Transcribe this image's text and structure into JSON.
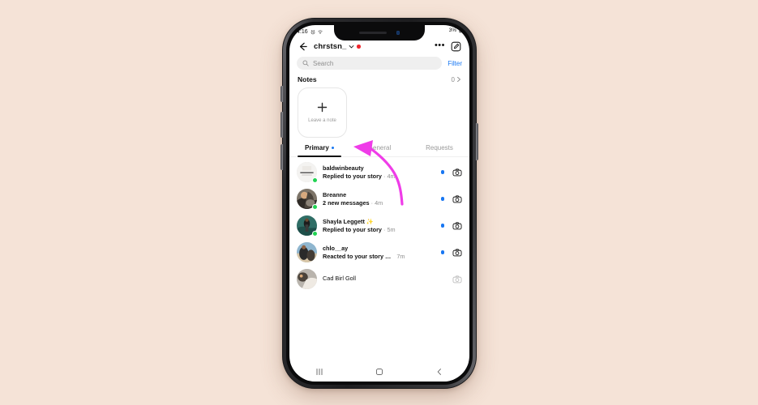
{
  "page": {
    "background_color": "#f5e3d7",
    "device": "smartphone-mockup"
  },
  "status_bar": {
    "time": "4:16",
    "battery_text": "3%",
    "icons": [
      "alarm-icon",
      "wifi-icon",
      "battery-icon"
    ]
  },
  "header": {
    "back_label": "Back",
    "username": "chrstsn_",
    "has_unread_badge": true,
    "more_label": "•••",
    "compose_label": "New message"
  },
  "search": {
    "placeholder": "Search",
    "filter_label": "Filter"
  },
  "notes": {
    "title": "Notes",
    "count": "0",
    "card_label": "Leave a note",
    "plus_label": "+"
  },
  "tabs": [
    {
      "label": "Primary",
      "active": true,
      "dot": true
    },
    {
      "label": "General",
      "active": false,
      "dot": false
    },
    {
      "label": "Requests",
      "active": false,
      "dot": false
    }
  ],
  "messages": [
    {
      "name": "baldwinbeauty",
      "preview": "Replied to your story",
      "time": "4m",
      "separator": "·",
      "unread": true,
      "online": true,
      "avatar_style": "light"
    },
    {
      "name": "Breanne",
      "preview": "2 new messages",
      "time": "4m",
      "separator": "·",
      "unread": true,
      "online": true,
      "avatar_style": "dark-photo"
    },
    {
      "name": "Shayla Leggett ✨",
      "preview": "Replied to your story",
      "time": "5m",
      "separator": "·",
      "unread": true,
      "online": true,
      "avatar_style": "teal-photo"
    },
    {
      "name": "chlo__ay",
      "preview": "Reacted to your story …",
      "time": "7m",
      "separator": "",
      "unread": true,
      "online": false,
      "avatar_style": "beach-photo"
    },
    {
      "name": "Cad Birl Goll",
      "preview": "",
      "time": "",
      "separator": "",
      "unread": false,
      "online": false,
      "avatar_style": "grey-photo"
    }
  ],
  "android_nav": {
    "recents_label": "Recent apps",
    "home_label": "Home",
    "back_label": "Back"
  },
  "annotation": {
    "type": "curved-arrow",
    "color": "#ef3ce8",
    "points_to": "leave-a-note-card"
  },
  "colors": {
    "accent_blue": "#1877f2",
    "online_green": "#21d352",
    "badge_red": "#f0262d",
    "annotation_pink": "#ef3ce8",
    "text_primary": "#111111",
    "text_muted": "#8e8e8e"
  }
}
